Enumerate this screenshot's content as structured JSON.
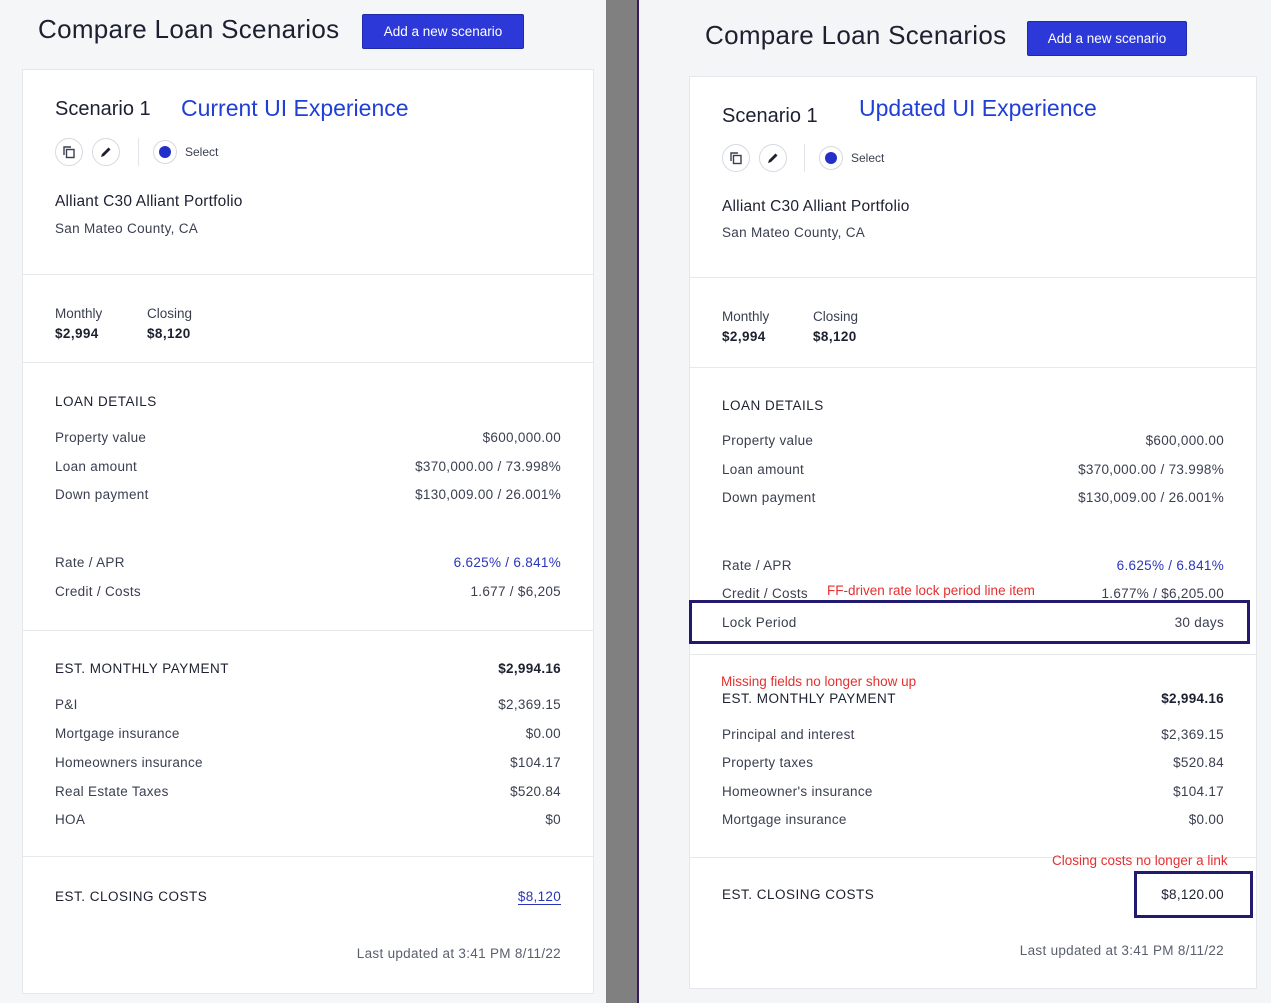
{
  "common": {
    "page_title": "Compare Loan Scenarios",
    "add_button": "Add a new scenario",
    "scenario_title": "Scenario 1",
    "select_label": "Select",
    "product": "Alliant C30 Alliant Portfolio",
    "county": "San Mateo County, CA",
    "monthly_label": "Monthly",
    "monthly_value": "$2,994",
    "closing_label": "Closing",
    "closing_value": "$8,120",
    "loan_details_heading": "LOAN DETAILS",
    "property_value_label": "Property value",
    "property_value": "$600,000.00",
    "loan_amount_label": "Loan amount",
    "loan_amount": "$370,000.00 / 73.998%",
    "down_payment_label": "Down payment",
    "down_payment": "$130,009.00 / 26.001%",
    "rate_label": "Rate / APR",
    "rate_value": "6.625% / 6.841%",
    "credit_label": "Credit / Costs",
    "est_monthly_heading": "EST. MONTHLY PAYMENT",
    "est_monthly_total": "$2,994.16",
    "est_closing_heading": "EST. CLOSING COSTS",
    "last_updated": "Last updated at 3:41 PM 8/11/22"
  },
  "left": {
    "tag": "Current UI Experience",
    "credit_value": "1.677 / $6,205",
    "payment_rows": [
      {
        "label": "P&I",
        "value": "$2,369.15"
      },
      {
        "label": "Mortgage insurance",
        "value": "$0.00"
      },
      {
        "label": "Homeowners insurance",
        "value": "$104.17"
      },
      {
        "label": "Real Estate Taxes",
        "value": "$520.84"
      },
      {
        "label": "HOA",
        "value": "$0"
      }
    ],
    "closing_cost_link": "$8,120"
  },
  "right": {
    "tag": "Updated UI Experience",
    "credit_value": "1.677% / $6,205.00",
    "lock_label": "Lock Period",
    "lock_value": "30 days",
    "payment_rows": [
      {
        "label": "Principal and interest",
        "value": "$2,369.15"
      },
      {
        "label": "Property taxes",
        "value": "$520.84"
      },
      {
        "label": "Homeowner's insurance",
        "value": "$104.17"
      },
      {
        "label": "Mortgage insurance",
        "value": "$0.00"
      }
    ],
    "closing_cost_value": "$8,120.00",
    "annotations": {
      "lock": "FF-driven rate lock period line item",
      "missing": "Missing fields no longer show up",
      "closing": "Closing costs no longer a link"
    }
  },
  "colors": {
    "accent_button": "#2c39d8",
    "link_blue": "#2a36b8",
    "annotation_red": "#e43030",
    "highlight_box": "#221a6e"
  },
  "icons": [
    "copy-icon",
    "pencil-icon",
    "radio-selected-icon"
  ]
}
